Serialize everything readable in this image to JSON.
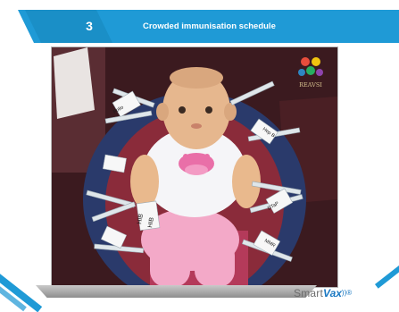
{
  "slide": {
    "number": "3",
    "title": "Crowded immunisation schedule"
  },
  "photo": {
    "logo_text": "REAVSI",
    "syringe_labels": [
      "HIB",
      "HIB",
      "Polio",
      "Hep B",
      "DTaP",
      "MMR"
    ]
  },
  "brand": {
    "name_main": "Smart",
    "name_accent": "Vax",
    "wave_glyph": "))",
    "registered": "®"
  },
  "colors": {
    "accent_blue": "#1f9ad6",
    "footer_grey": "#a8a8a8",
    "brand_blue": "#1a78c2"
  }
}
